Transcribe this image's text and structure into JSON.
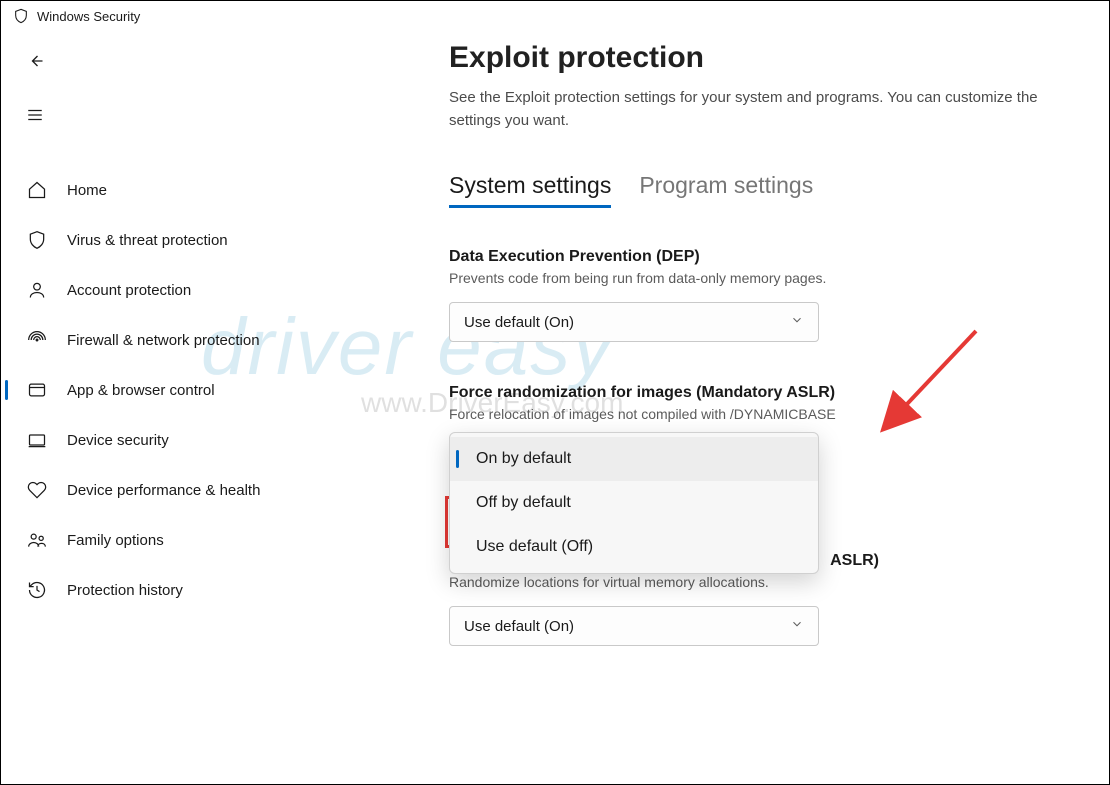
{
  "window": {
    "title": "Windows Security"
  },
  "sidebar": {
    "items": [
      {
        "label": "Home",
        "icon": "home-icon"
      },
      {
        "label": "Virus & threat protection",
        "icon": "shield-icon"
      },
      {
        "label": "Account protection",
        "icon": "account-icon"
      },
      {
        "label": "Firewall & network protection",
        "icon": "firewall-icon"
      },
      {
        "label": "App & browser control",
        "icon": "app-browser-icon",
        "active": true
      },
      {
        "label": "Device security",
        "icon": "device-icon"
      },
      {
        "label": "Device performance & health",
        "icon": "health-icon"
      },
      {
        "label": "Family options",
        "icon": "family-icon"
      },
      {
        "label": "Protection history",
        "icon": "history-icon"
      }
    ]
  },
  "page": {
    "title": "Exploit protection",
    "description": "See the Exploit protection settings for your system and programs.  You can customize the settings you want."
  },
  "tabs": [
    {
      "label": "System settings",
      "active": true
    },
    {
      "label": "Program settings"
    }
  ],
  "settings": {
    "dep": {
      "title": "Data Execution Prevention (DEP)",
      "desc": "Prevents code from being run from data-only memory pages.",
      "value": "Use default (On)"
    },
    "aslr": {
      "title": "Force randomization for images (Mandatory ASLR)",
      "desc": "Force relocation of images not compiled with /DYNAMICBASE",
      "options": [
        {
          "label": "On by default",
          "selected": true
        },
        {
          "label": "Off by default"
        },
        {
          "label": "Use default (Off)"
        }
      ]
    },
    "bottomup": {
      "title_partial": "ASLR)",
      "desc": "Randomize locations for virtual memory allocations.",
      "value": "Use default (On)"
    }
  },
  "watermark": {
    "main": "driver easy",
    "sub": "www.DriverEasy.com"
  }
}
